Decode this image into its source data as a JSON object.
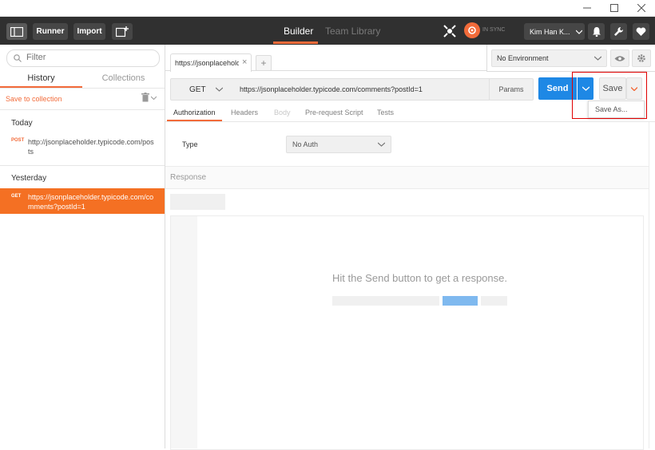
{
  "header": {
    "runner_label": "Runner",
    "import_label": "Import",
    "tabs": [
      {
        "label": "Builder"
      },
      {
        "label": "Team Library"
      }
    ],
    "sync_status": "IN SYNC",
    "user_name": "Kim Han K..."
  },
  "sidebar": {
    "filter_placeholder": "Filter",
    "tabs": [
      {
        "label": "History"
      },
      {
        "label": "Collections"
      }
    ],
    "save_to_collection": "Save to collection",
    "sections": [
      {
        "label": "Today",
        "items": [
          {
            "method": "POST",
            "url": "http://jsonplaceholder.typicode.com/posts"
          }
        ]
      },
      {
        "label": "Yesterday",
        "items": [
          {
            "method": "GET",
            "url": "https://jsonplaceholder.typicode.com/comments?postId=1"
          }
        ]
      }
    ]
  },
  "request_tab": {
    "label": "https://jsonplaceholde",
    "close": "×",
    "add": "+"
  },
  "environment": {
    "selected": "No Environment"
  },
  "request": {
    "method": "GET",
    "url": "https://jsonplaceholder.typicode.com/comments?postId=1",
    "params_label": "Params",
    "send_label": "Send",
    "save_label": "Save",
    "save_as_label": "Save As..."
  },
  "subtabs": [
    {
      "label": "Authorization"
    },
    {
      "label": "Headers"
    },
    {
      "label": "Body"
    },
    {
      "label": "Pre-request Script"
    },
    {
      "label": "Tests"
    }
  ],
  "auth": {
    "type_label": "Type",
    "type_value": "No Auth"
  },
  "response": {
    "label": "Response",
    "hint": "Hit the Send button to get a response."
  },
  "colors": {
    "accent": "#f26b3a",
    "send_blue": "#1e88e5",
    "header_bg": "#303030",
    "highlight_red": "#e00000"
  }
}
